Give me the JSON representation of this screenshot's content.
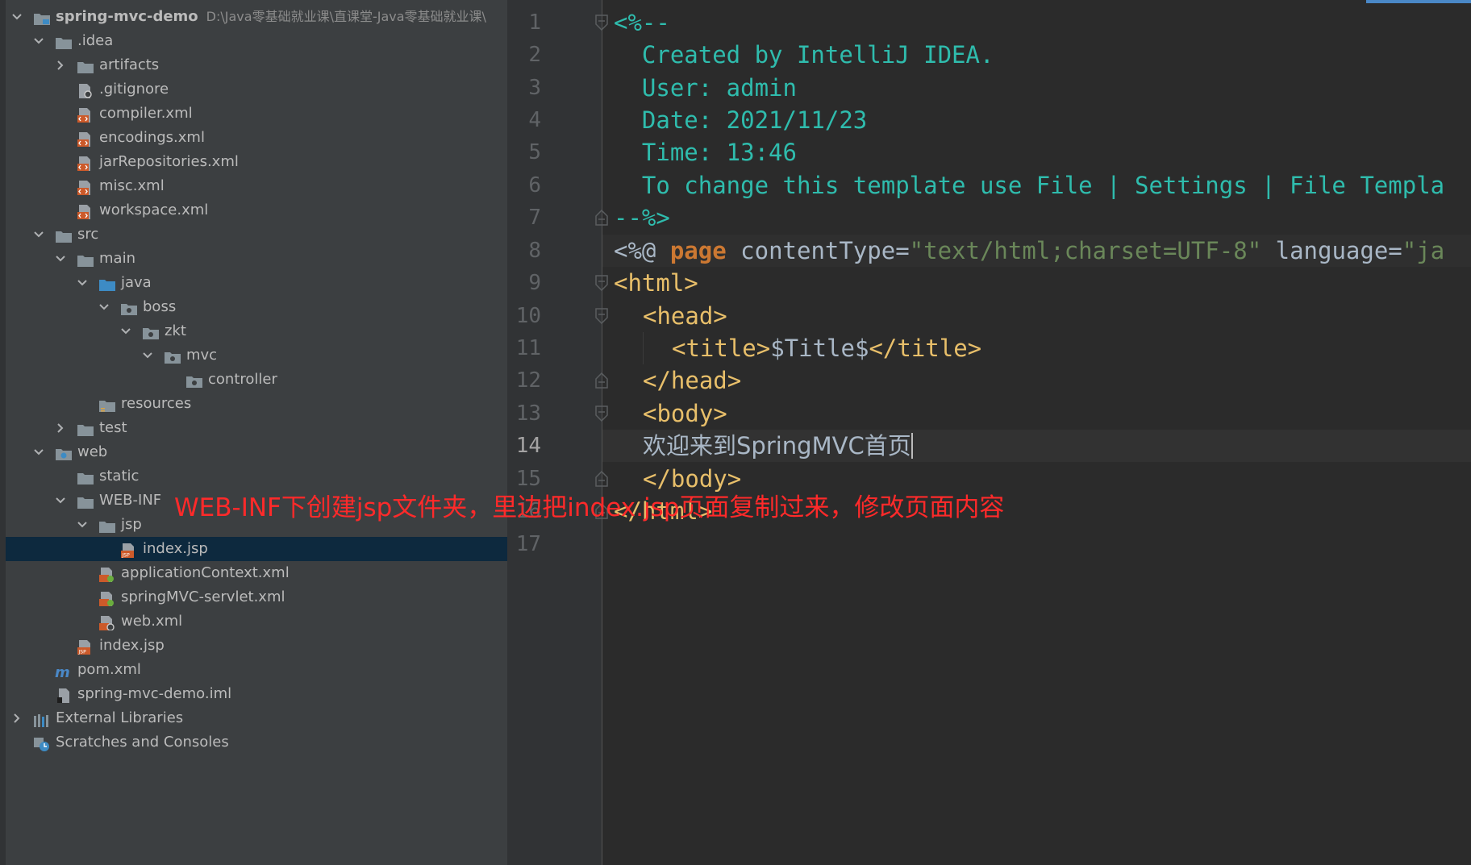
{
  "project_tree": {
    "root": {
      "label": "spring-mvc-demo",
      "path": "D:\\Java零基础就业课\\直课堂-Java零基础就业课\\"
    },
    "items": [
      {
        "label": ".idea"
      },
      {
        "label": "artifacts"
      },
      {
        "label": ".gitignore"
      },
      {
        "label": "compiler.xml"
      },
      {
        "label": "encodings.xml"
      },
      {
        "label": "jarRepositories.xml"
      },
      {
        "label": "misc.xml"
      },
      {
        "label": "workspace.xml"
      },
      {
        "label": "src"
      },
      {
        "label": "main"
      },
      {
        "label": "java"
      },
      {
        "label": "boss"
      },
      {
        "label": "zkt"
      },
      {
        "label": "mvc"
      },
      {
        "label": "controller"
      },
      {
        "label": "resources"
      },
      {
        "label": "test"
      },
      {
        "label": "web"
      },
      {
        "label": "static"
      },
      {
        "label": "WEB-INF"
      },
      {
        "label": "jsp"
      },
      {
        "label": "index.jsp"
      },
      {
        "label": "applicationContext.xml"
      },
      {
        "label": "springMVC-servlet.xml"
      },
      {
        "label": "web.xml"
      },
      {
        "label": "index.jsp"
      },
      {
        "label": "pom.xml"
      },
      {
        "label": "spring-mvc-demo.iml"
      },
      {
        "label": "External Libraries"
      },
      {
        "label": "Scratches and Consoles"
      }
    ],
    "selected": "index.jsp"
  },
  "editor": {
    "line_numbers": [
      "1",
      "2",
      "3",
      "4",
      "5",
      "6",
      "7",
      "8",
      "9",
      "10",
      "11",
      "12",
      "13",
      "14",
      "15",
      "16",
      "17"
    ],
    "current_line": "14",
    "lines": {
      "l1": "<%--",
      "l2": "  Created by IntelliJ IDEA.",
      "l3": "  User: admin",
      "l4": "  Date: 2021/11/23",
      "l5": "  Time: 13:46",
      "l6": "  To change this template use File | Settings | File Templa",
      "l7": "--%>",
      "l8": {
        "open": "<%@ ",
        "kw": "page",
        "attr1": " contentType=",
        "val1": "\"text/html;charset=UTF-8\"",
        "attr2": " language=",
        "val2": "\"ja"
      },
      "l9": "<html>",
      "l10": "<head>",
      "l11": {
        "open": "<title>",
        "text": "$Title$",
        "close": "</title>"
      },
      "l12": "</head>",
      "l13": "<body>",
      "l14": "欢迎来到SpringMVC首页",
      "l15": "</body>",
      "l16": "</html>",
      "l17": ""
    }
  },
  "annotation": "WEB-INF下创建jsp文件夹，里边把index.jsp页面复制过来，修改页面内容",
  "colors": {
    "tree_bg": "#3c3f41",
    "editor_bg": "#2b2b2b",
    "selection": "#0d293e",
    "comment": "#2fbcad",
    "tag": "#e8bf6a",
    "keyword": "#cc7832",
    "string": "#6a8759",
    "annotation": "#ff2a2a"
  }
}
